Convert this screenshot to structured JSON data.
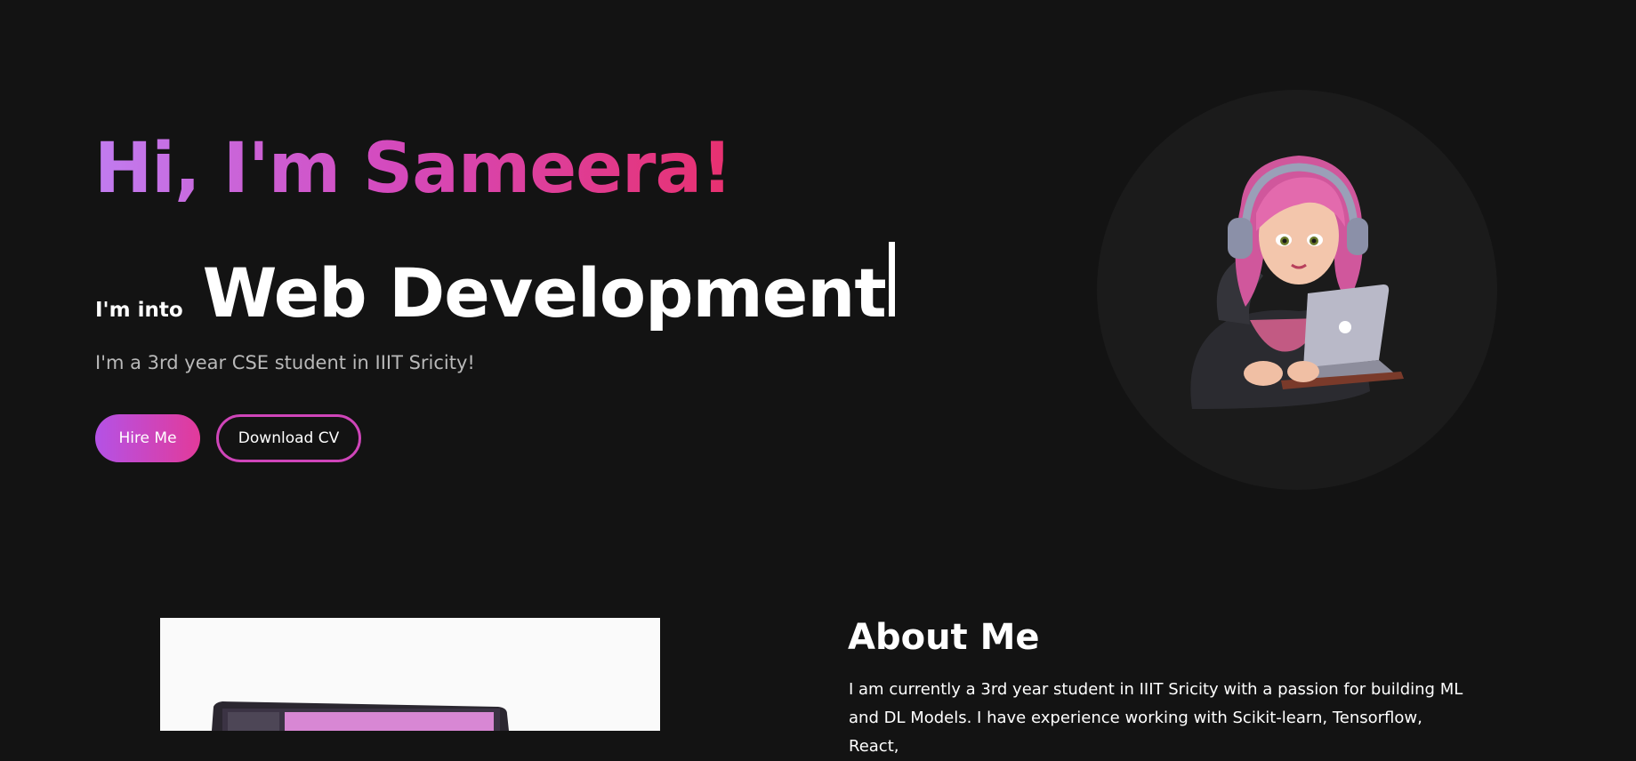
{
  "hero": {
    "greeting": "Hi, I'm Sameera!",
    "into_label": "I'm into",
    "typed_text": "Web Development",
    "subtitle": "I'm a 3rd year CSE student in IIIT Sricity!",
    "hire_button": "Hire Me",
    "cv_button": "Download CV"
  },
  "about": {
    "title": "About Me",
    "text": "I am currently a 3rd year student in IIIT Sricity with a passion for building ML and DL Models. I have experience working with Scikit-learn, Tensorflow, React,"
  },
  "colors": {
    "background": "#131313",
    "accent_start": "#b452e6",
    "accent_end": "#e23a9a",
    "subtitle": "#b9b9b9"
  },
  "icons": {
    "avatar": "girl-with-headphones-and-laptop-illustration",
    "about_image": "laptop-photo"
  }
}
